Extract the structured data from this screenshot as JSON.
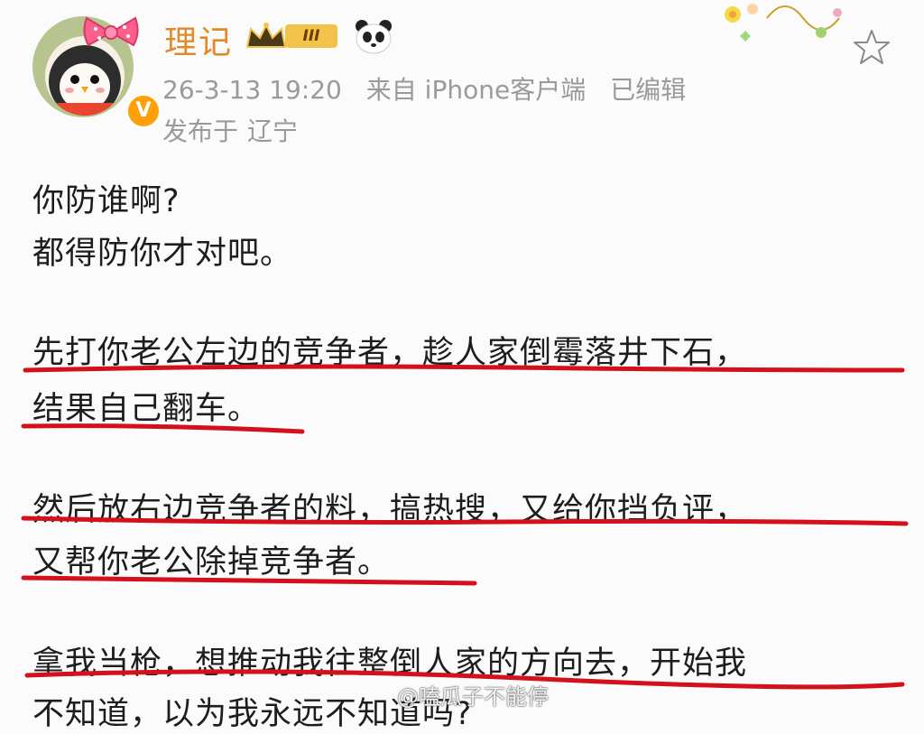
{
  "user": {
    "name": "理记",
    "level": "III"
  },
  "post_meta": {
    "datetime": "26-3-13 19:20",
    "source": "来自 iPhone客户端",
    "edited": "已编辑",
    "location_label": "发布于",
    "location": "辽宁"
  },
  "post_text": {
    "p1_line1": "你防谁啊?",
    "p1_line2": "都得防你才对吧。",
    "p2_line1": "先打你老公左边的竞争者，趁人家倒霉落井下石，",
    "p2_line2": "结果自己翻车。",
    "p3_line1": "然后放右边竞争者的料，搞热搜，又给你挡负评，",
    "p3_line2": "又帮你老公除掉竞争者。",
    "p4_line1": "拿我当枪，想推动我往整倒人家的方向去，开始我",
    "p4_line2": "不知道，以为我永远不知道吗?"
  },
  "watermark": "@嗑瓜子不能停",
  "icons": {
    "avatar": "avatar-penguin",
    "verified": "verified-badge-icon",
    "panda": "panda-icon",
    "vlog_sticker": "vlog-sticker",
    "favorite": "star-icon"
  },
  "colors": {
    "name": "#e08a2a",
    "meta": "#9a9a9a",
    "underline": "#d4111b",
    "verified": "#ff9f0a"
  }
}
